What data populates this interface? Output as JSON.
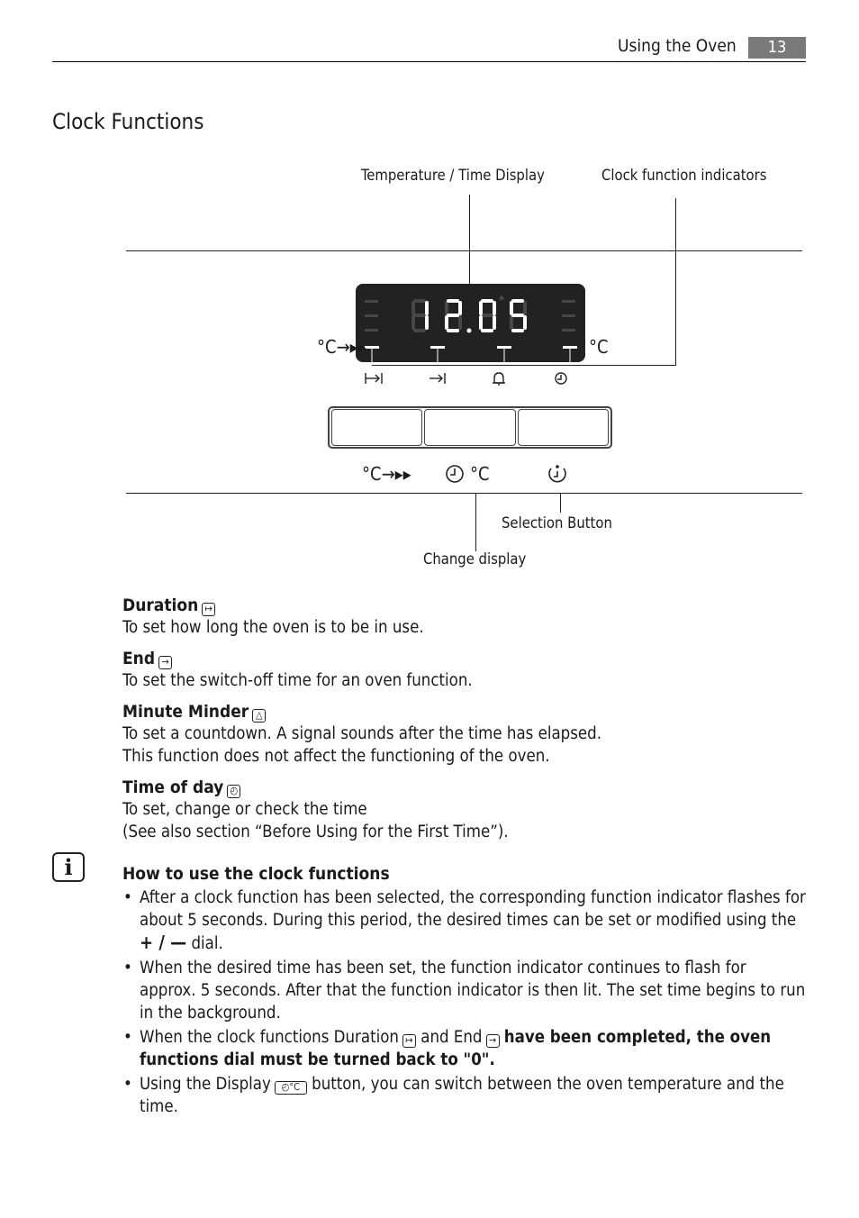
{
  "header": {
    "section": "Using the Oven",
    "page_number": "13"
  },
  "title": "Clock Functions",
  "diagram": {
    "labels": {
      "display": "Temperature / Time Display",
      "indicators": "Clock function indicators",
      "selection": "Selection Button",
      "change": "Change display"
    },
    "display_digits": "12.05",
    "left_symbol": "°C→▸▸",
    "right_symbol": "°C",
    "indicator_icons": [
      "duration-icon",
      "end-icon",
      "bell-icon",
      "clock-icon"
    ],
    "buttons": [
      {
        "label": "°C→▸▸",
        "icon": "fast-heat-icon"
      },
      {
        "label": "°C",
        "icon": "clock-temp-icon"
      },
      {
        "label": "",
        "icon": "selection-icon"
      }
    ]
  },
  "functions": [
    {
      "name": "Duration",
      "icon": "duration-icon",
      "glyph": "↦",
      "desc": [
        "To set how long the oven is to be in use."
      ]
    },
    {
      "name": "End",
      "icon": "end-icon",
      "glyph": "→",
      "desc": [
        "To set the switch-off time for an oven function."
      ]
    },
    {
      "name": "Minute Minder",
      "icon": "bell-icon",
      "glyph": "♪",
      "desc": [
        "To set a countdown. A signal sounds after the time has elapsed.",
        "This function does not affect the functioning of the oven."
      ]
    },
    {
      "name": "Time of day",
      "icon": "clock-icon",
      "glyph": "◴",
      "desc": [
        "To set, change or check the time",
        "(See also section “Before Using for the First Time”)."
      ]
    }
  ],
  "info": {
    "icon": "i",
    "heading": "How to use the clock functions",
    "bullets": {
      "b1": "After a clock function has been selected, the corresponding function indicator flashes for about 5 seconds. During this period, the desired times can be set or modified using the",
      "b1_dial": "+ / —",
      "b1_end": "dial.",
      "b2": "When the desired time has been set, the function indicator continues to flash for approx. 5 seconds. After that the function indicator is then lit. The set time begins to run in the background.",
      "b3_a": "When the clock functions Duration",
      "b3_b": "and End",
      "b3_bold": "have been completed, the oven functions dial must be turned back to \"0\".",
      "b4_a": "Using the  Display",
      "b4_b": "button, you can switch between the oven temperature and the time."
    }
  }
}
